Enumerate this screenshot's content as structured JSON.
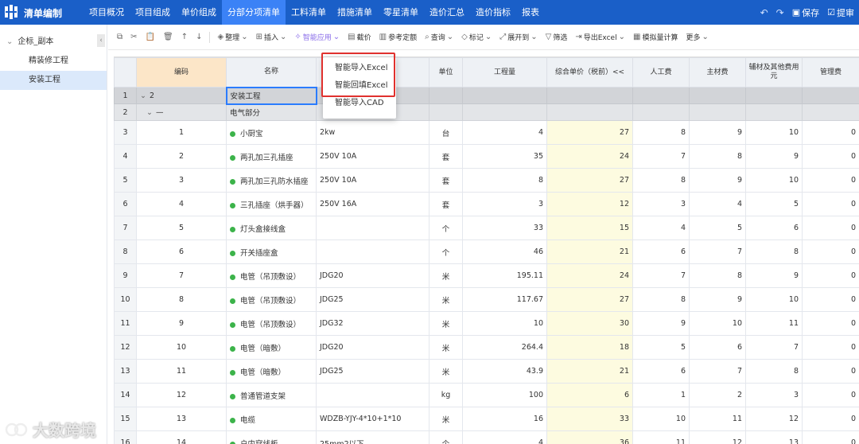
{
  "app": {
    "title": "清单编制"
  },
  "nav": {
    "tabs": [
      {
        "label": "项目概况"
      },
      {
        "label": "项目组成"
      },
      {
        "label": "单价组成"
      },
      {
        "label": "分部分项清单",
        "active": true
      },
      {
        "label": "工料清单"
      },
      {
        "label": "措施清单"
      },
      {
        "label": "零星清单"
      },
      {
        "label": "造价汇总"
      },
      {
        "label": "造价指标"
      },
      {
        "label": "报表"
      }
    ]
  },
  "topright": {
    "save": "保存",
    "submit": "提审"
  },
  "sidebar": {
    "root": "企标_副本",
    "items": [
      {
        "label": "精装修工程"
      },
      {
        "label": "安装工程",
        "selected": true
      }
    ]
  },
  "toolbar": {
    "organize": "整理",
    "insert": "插入",
    "smart": "智能应用",
    "group_price": "截价",
    "ref_quota": "参考定额",
    "query": "查询",
    "mark": "标记",
    "expand": "展开到",
    "filter": "筛选",
    "export": "导出Excel",
    "simulate": "模拟量计算",
    "more": "更多"
  },
  "dropdown": {
    "items": [
      "智能导入Excel",
      "智能回填Excel",
      "智能导入CAD"
    ]
  },
  "grid": {
    "headers": [
      "",
      "编码",
      "名称",
      "",
      "单位",
      "工程量",
      "综合单价（税前）<<",
      "人工费",
      "主材费",
      "辅材及其他费用元",
      "管理费"
    ],
    "group_rows": [
      {
        "rn": "1",
        "code": "2",
        "name": "安装工程"
      },
      {
        "rn": "2",
        "code": "—",
        "name": "电气部分"
      }
    ],
    "rows": [
      {
        "rn": "3",
        "code": "1",
        "name": "小厨宝",
        "spec": "2kw",
        "unit": "台",
        "qty": "4",
        "price": "27",
        "labor": "8",
        "main": "9",
        "aux": "10",
        "mgmt": "0"
      },
      {
        "rn": "4",
        "code": "2",
        "name": "两孔加三孔插座",
        "spec": "250V 10A",
        "unit": "套",
        "qty": "35",
        "price": "24",
        "labor": "7",
        "main": "8",
        "aux": "9",
        "mgmt": "0"
      },
      {
        "rn": "5",
        "code": "3",
        "name": "两孔加三孔防水插座",
        "spec": "250V 10A",
        "unit": "套",
        "qty": "8",
        "price": "27",
        "labor": "8",
        "main": "9",
        "aux": "10",
        "mgmt": "0"
      },
      {
        "rn": "6",
        "code": "4",
        "name": "三孔插座（烘手器）",
        "spec": "250V 16A",
        "unit": "套",
        "qty": "3",
        "price": "12",
        "labor": "3",
        "main": "4",
        "aux": "5",
        "mgmt": "0"
      },
      {
        "rn": "7",
        "code": "5",
        "name": "灯头盒接线盒",
        "spec": "",
        "unit": "个",
        "qty": "33",
        "price": "15",
        "labor": "4",
        "main": "5",
        "aux": "6",
        "mgmt": "0"
      },
      {
        "rn": "8",
        "code": "6",
        "name": "开关插座盒",
        "spec": "",
        "unit": "个",
        "qty": "46",
        "price": "21",
        "labor": "6",
        "main": "7",
        "aux": "8",
        "mgmt": "0"
      },
      {
        "rn": "9",
        "code": "7",
        "name": "电管（吊顶敷设）",
        "spec": "JDG20",
        "unit": "米",
        "qty": "195.11",
        "price": "24",
        "labor": "7",
        "main": "8",
        "aux": "9",
        "mgmt": "0"
      },
      {
        "rn": "10",
        "code": "8",
        "name": "电管（吊顶敷设）",
        "spec": "JDG25",
        "unit": "米",
        "qty": "117.67",
        "price": "27",
        "labor": "8",
        "main": "9",
        "aux": "10",
        "mgmt": "0"
      },
      {
        "rn": "11",
        "code": "9",
        "name": "电管（吊顶敷设）",
        "spec": "JDG32",
        "unit": "米",
        "qty": "10",
        "price": "30",
        "labor": "9",
        "main": "10",
        "aux": "11",
        "mgmt": "0"
      },
      {
        "rn": "12",
        "code": "10",
        "name": "电管（暗敷）",
        "spec": "JDG20",
        "unit": "米",
        "qty": "264.4",
        "price": "18",
        "labor": "5",
        "main": "6",
        "aux": "7",
        "mgmt": "0"
      },
      {
        "rn": "13",
        "code": "11",
        "name": "电管（暗敷）",
        "spec": "JDG25",
        "unit": "米",
        "qty": "43.9",
        "price": "21",
        "labor": "6",
        "main": "7",
        "aux": "8",
        "mgmt": "0"
      },
      {
        "rn": "14",
        "code": "12",
        "name": "普通管道支架",
        "spec": "",
        "unit": "kg",
        "qty": "100",
        "price": "6",
        "labor": "1",
        "main": "2",
        "aux": "3",
        "mgmt": "0"
      },
      {
        "rn": "15",
        "code": "13",
        "name": "电缆",
        "spec": "WDZB-YJY-4*10+1*10",
        "unit": "米",
        "qty": "16",
        "price": "33",
        "labor": "10",
        "main": "11",
        "aux": "12",
        "mgmt": "0"
      },
      {
        "rn": "16",
        "code": "14",
        "name": "户内穿线板",
        "spec": "25mm2以下",
        "unit": "个",
        "qty": "4",
        "price": "36",
        "labor": "11",
        "main": "12",
        "aux": "13",
        "mgmt": "0"
      }
    ]
  },
  "watermark": {
    "text": "大数跨境"
  }
}
